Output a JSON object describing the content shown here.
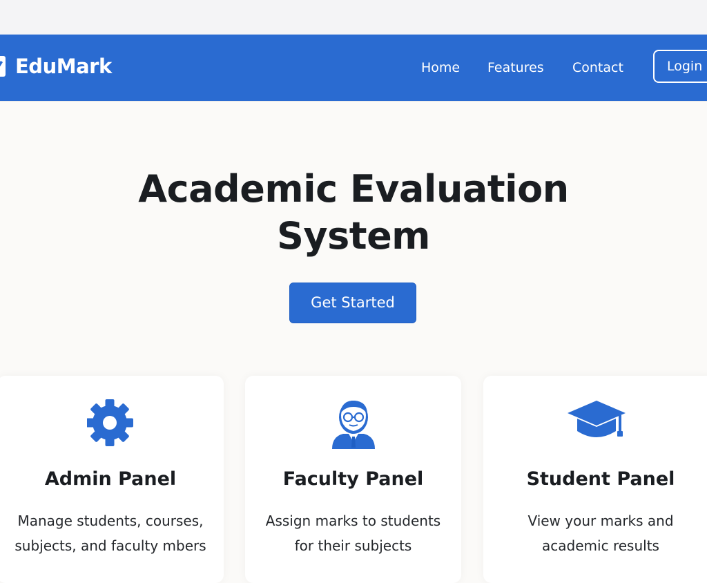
{
  "brand": {
    "name": "EduMark",
    "icon": "edumark-logo-icon"
  },
  "nav": {
    "items": [
      {
        "label": "Home"
      },
      {
        "label": "Features"
      },
      {
        "label": "Contact"
      }
    ],
    "login_label": "Login"
  },
  "hero": {
    "title_line1": "Academic Evaluation",
    "title_line2": "System",
    "cta_label": "Get Started"
  },
  "cards": [
    {
      "icon": "gear-icon",
      "title": "Admin Panel",
      "desc_line1": "Manage students, courses,",
      "desc_line2": "subjects, and faculty mbers"
    },
    {
      "icon": "faculty-person-icon",
      "title": "Faculty Panel",
      "desc_line1": "Assign marks to students",
      "desc_line2": "for their subjects"
    },
    {
      "icon": "graduation-cap-icon",
      "title": "Student Panel",
      "desc_line1": "View your marks and",
      "desc_line2": "academic results"
    }
  ],
  "colors": {
    "primary": "#2a6bd1",
    "background": "#fbfaf8",
    "text": "#1a1d21",
    "card": "#ffffff"
  }
}
